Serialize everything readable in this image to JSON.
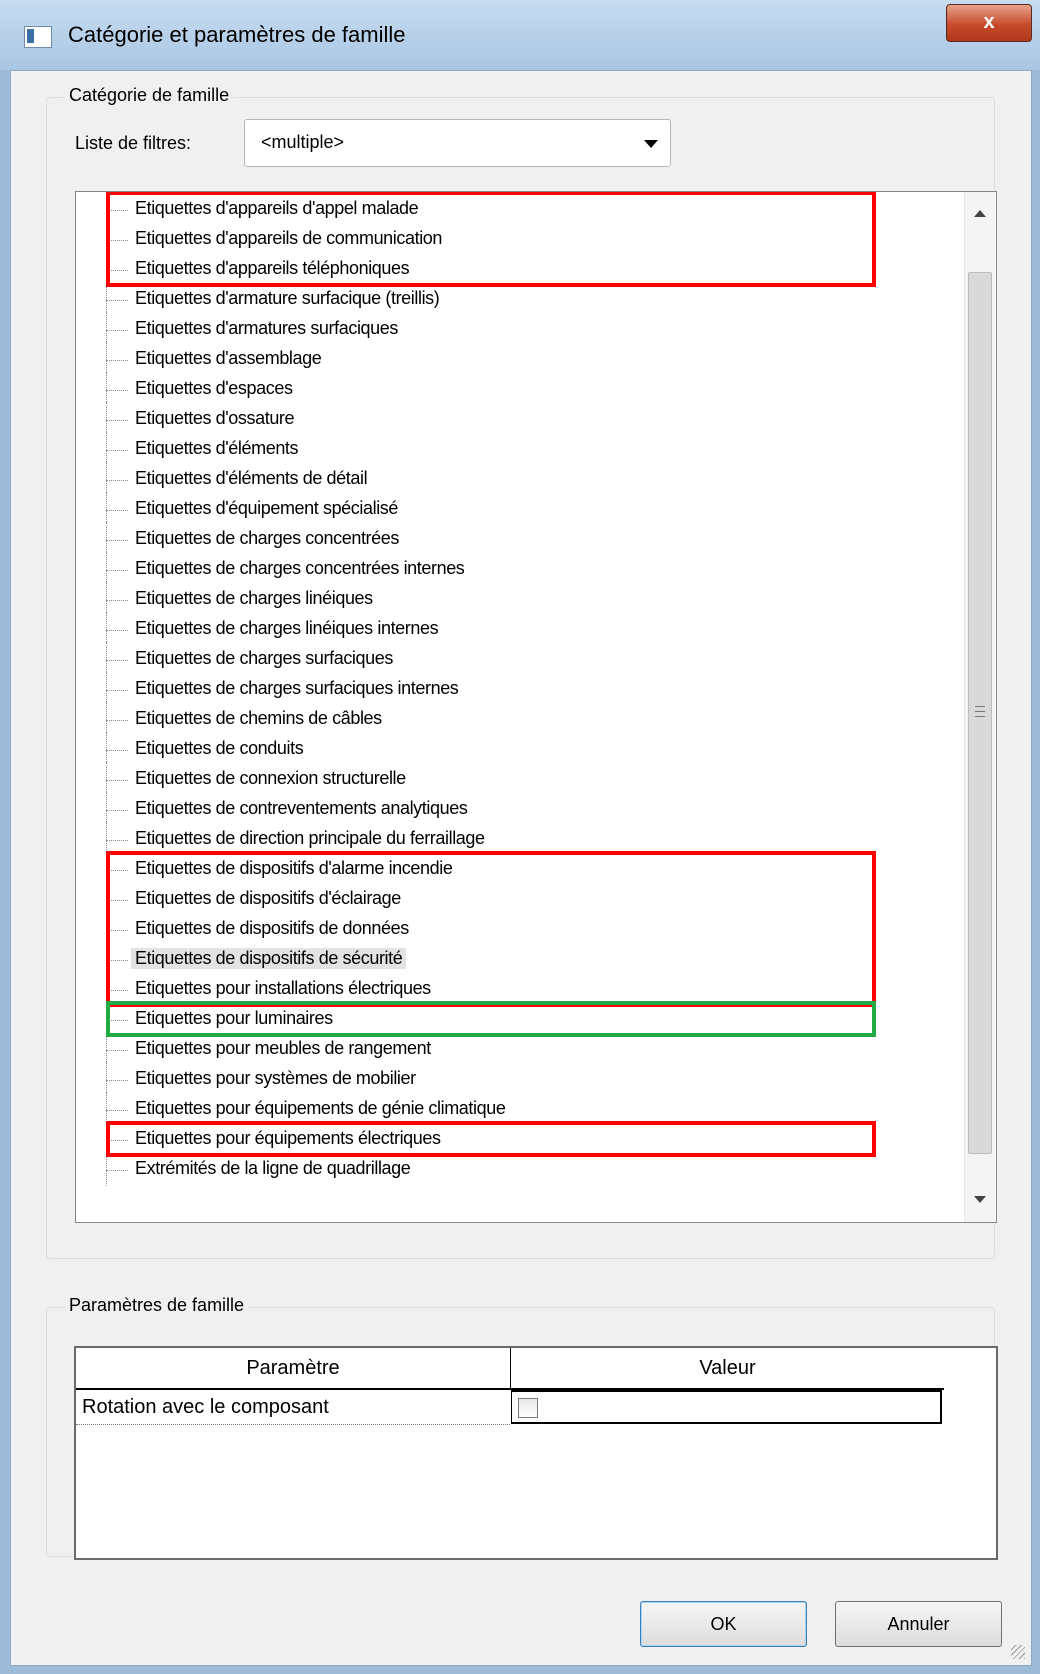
{
  "window": {
    "title": "Catégorie et paramètres de famille",
    "close_label": "x"
  },
  "category_group": {
    "legend": "Catégorie de famille",
    "filter_label": "Liste de filtres:",
    "filter_value": "<multiple>"
  },
  "tree": {
    "items": [
      {
        "label": "Etiquettes d'appareils d'appel malade"
      },
      {
        "label": "Etiquettes d'appareils de communication"
      },
      {
        "label": "Etiquettes d'appareils téléphoniques"
      },
      {
        "label": "Etiquettes d'armature surfacique (treillis)"
      },
      {
        "label": "Etiquettes d'armatures surfaciques"
      },
      {
        "label": "Etiquettes d'assemblage"
      },
      {
        "label": "Etiquettes d'espaces"
      },
      {
        "label": "Etiquettes d'ossature"
      },
      {
        "label": "Etiquettes d'éléments"
      },
      {
        "label": "Etiquettes d'éléments de détail"
      },
      {
        "label": "Etiquettes d'équipement spécialisé"
      },
      {
        "label": "Etiquettes de charges concentrées"
      },
      {
        "label": "Etiquettes de charges concentrées internes"
      },
      {
        "label": "Etiquettes de charges linéiques"
      },
      {
        "label": "Etiquettes de charges linéiques internes"
      },
      {
        "label": "Etiquettes de charges surfaciques"
      },
      {
        "label": "Etiquettes de charges surfaciques internes"
      },
      {
        "label": "Etiquettes de chemins de câbles"
      },
      {
        "label": "Etiquettes de conduits"
      },
      {
        "label": "Etiquettes de connexion structurelle"
      },
      {
        "label": "Etiquettes de contreventements analytiques"
      },
      {
        "label": "Etiquettes de direction principale du ferraillage"
      },
      {
        "label": "Etiquettes de dispositifs d'alarme incendie"
      },
      {
        "label": "Etiquettes de dispositifs d'éclairage"
      },
      {
        "label": "Etiquettes de dispositifs de données"
      },
      {
        "label": "Etiquettes de dispositifs de sécurité",
        "selected": true
      },
      {
        "label": "Etiquettes pour installations électriques"
      },
      {
        "label": "Etiquettes pour luminaires"
      },
      {
        "label": "Etiquettes pour meubles de rangement"
      },
      {
        "label": "Etiquettes pour systèmes de mobilier"
      },
      {
        "label": "Etiquettes pour équipements de génie climatique"
      },
      {
        "label": "Etiquettes pour équipements électriques"
      },
      {
        "label": "Extrémités de la ligne de quadrillage"
      }
    ]
  },
  "annotations": {
    "colors": {
      "red": "#ff0000",
      "green": "#22aa44"
    }
  },
  "params_group": {
    "legend": "Paramètres de famille",
    "col_param": "Paramètre",
    "col_value": "Valeur",
    "rows": [
      {
        "name": "Rotation avec le composant",
        "checked": false
      }
    ]
  },
  "buttons": {
    "ok": "OK",
    "cancel": "Annuler"
  }
}
